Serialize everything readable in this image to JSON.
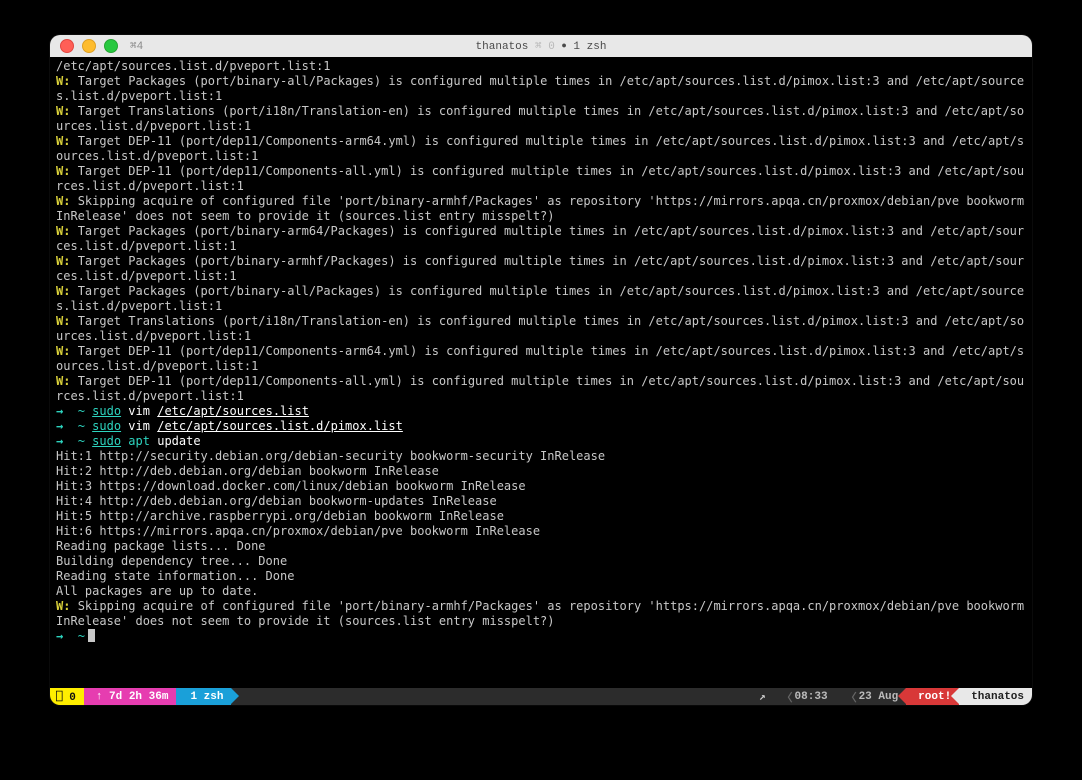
{
  "title": {
    "left_shortcut": "⌘4",
    "host": "thanatos",
    "inactive": "⌘ 0",
    "active_sep": "●",
    "active": "1 zsh"
  },
  "warn": [
    "/etc/apt/sources.list.d/pveport.list:1",
    "Target Packages (port/binary-all/Packages) is configured multiple times in /etc/apt/sources.list.d/pimox.list:3 and /etc/apt/sources.list.d/pveport.list:1",
    "Target Translations (port/i18n/Translation-en) is configured multiple times in /etc/apt/sources.list.d/pimox.list:3 and /etc/apt/sources.list.d/pveport.list:1",
    "Target DEP-11 (port/dep11/Components-arm64.yml) is configured multiple times in /etc/apt/sources.list.d/pimox.list:3 and /etc/apt/sources.list.d/pveport.list:1",
    "Target DEP-11 (port/dep11/Components-all.yml) is configured multiple times in /etc/apt/sources.list.d/pimox.list:3 and /etc/apt/sources.list.d/pveport.list:1",
    "Skipping acquire of configured file 'port/binary-armhf/Packages' as repository 'https://mirrors.apqa.cn/proxmox/debian/pve bookworm InRelease' does not seem to provide it (sources.list entry misspelt?)",
    "Target Packages (port/binary-arm64/Packages) is configured multiple times in /etc/apt/sources.list.d/pimox.list:3 and /etc/apt/sources.list.d/pveport.list:1",
    "Target Packages (port/binary-armhf/Packages) is configured multiple times in /etc/apt/sources.list.d/pimox.list:3 and /etc/apt/sources.list.d/pveport.list:1",
    "Target Packages (port/binary-all/Packages) is configured multiple times in /etc/apt/sources.list.d/pimox.list:3 and /etc/apt/sources.list.d/pveport.list:1",
    "Target Translations (port/i18n/Translation-en) is configured multiple times in /etc/apt/sources.list.d/pimox.list:3 and /etc/apt/sources.list.d/pveport.list:1",
    "Target DEP-11 (port/dep11/Components-arm64.yml) is configured multiple times in /etc/apt/sources.list.d/pimox.list:3 and /etc/apt/sources.list.d/pveport.list:1",
    "Target DEP-11 (port/dep11/Components-all.yml) is configured multiple times in /etc/apt/sources.list.d/pimox.list:3 and /etc/apt/sources.list.d/pveport.list:1"
  ],
  "cmds": {
    "vim1": {
      "sudo": "sudo",
      "cmd": "vim",
      "path": "/etc/apt/sources.list"
    },
    "vim2": {
      "sudo": "sudo",
      "cmd": "vim",
      "path": "/etc/apt/sources.list.d/pimox.list"
    },
    "apt": {
      "sudo": "sudo",
      "cmd": "apt",
      "arg": "update"
    }
  },
  "hits": [
    "Hit:1 http://security.debian.org/debian-security bookworm-security InRelease",
    "Hit:2 http://deb.debian.org/debian bookworm InRelease",
    "Hit:3 https://download.docker.com/linux/debian bookworm InRelease",
    "Hit:4 http://deb.debian.org/debian bookworm-updates InRelease",
    "Hit:5 http://archive.raspberrypi.org/debian bookworm InRelease",
    "Hit:6 https://mirrors.apqa.cn/proxmox/debian/pve bookworm InRelease"
  ],
  "progress": [
    "Reading package lists... Done",
    "Building dependency tree... Done",
    "Reading state information... Done",
    "All packages are up to date."
  ],
  "postwarn": "Skipping acquire of configured file 'port/binary-armhf/Packages' as repository 'https://mirrors.apqa.cn/proxmox/debian/pve bookworm InRelease' does not seem to provide it (sources.list entry misspelt?)",
  "status": {
    "session": "⎕ 0",
    "uptime": "↑ 7d 2h 36m",
    "proc": "1 zsh",
    "arrow_glyph": "↗",
    "time": "08:33",
    "date": "23 Aug",
    "root": "root!",
    "host": "thanatos"
  }
}
